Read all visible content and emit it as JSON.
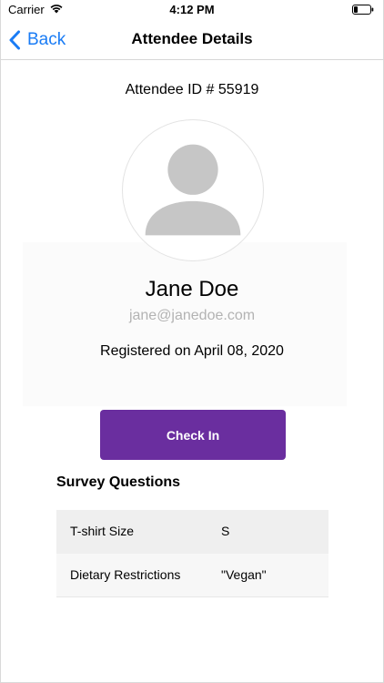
{
  "status_bar": {
    "carrier": "Carrier",
    "time": "4:12 PM"
  },
  "nav": {
    "back_label": "Back",
    "title": "Attendee Details"
  },
  "attendee": {
    "id_text": "Attendee ID # 55919",
    "name": "Jane Doe",
    "email": "jane@janedoe.com",
    "registered_text": "Registered on April 08, 2020"
  },
  "actions": {
    "check_in_label": "Check In"
  },
  "survey": {
    "title": "Survey Questions",
    "rows": [
      {
        "question": "T-shirt Size",
        "answer": "S"
      },
      {
        "question": "Dietary Restrictions",
        "answer": "\"Vegan\""
      }
    ]
  },
  "colors": {
    "accent_blue": "#1a7cf5",
    "button_purple": "#6a2e9f",
    "email_gray": "#b3b3b3"
  },
  "icons": {
    "back": "chevron-left-icon",
    "avatar": "person-silhouette-icon",
    "wifi": "wifi-icon",
    "battery": "battery-icon"
  }
}
